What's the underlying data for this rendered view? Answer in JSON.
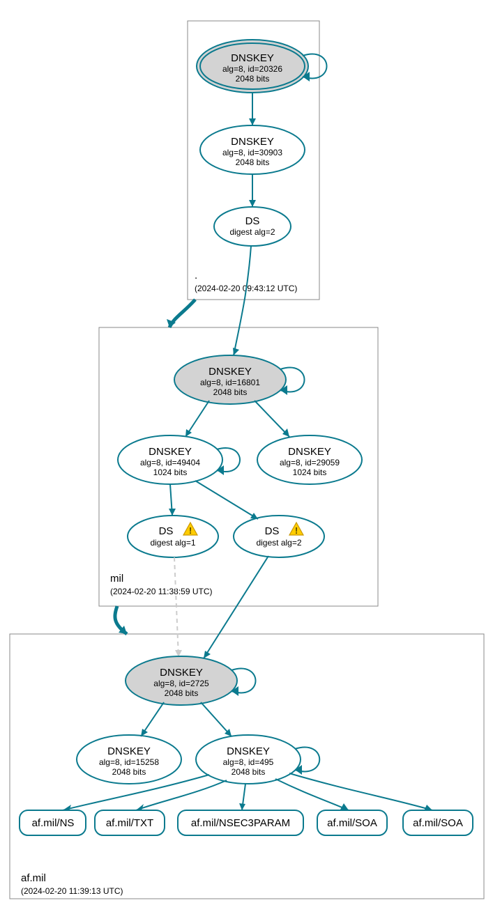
{
  "zones": {
    "root": {
      "label": ".",
      "time": "(2024-02-20 09:43:12 UTC)"
    },
    "mil": {
      "label": "mil",
      "time": "(2024-02-20 11:38:59 UTC)"
    },
    "afmil": {
      "label": "af.mil",
      "time": "(2024-02-20 11:39:13 UTC)"
    }
  },
  "nodes": {
    "root_ksk": {
      "t": "DNSKEY",
      "l1": "alg=8, id=20326",
      "l2": "2048 bits"
    },
    "root_zsk": {
      "t": "DNSKEY",
      "l1": "alg=8, id=30903",
      "l2": "2048 bits"
    },
    "root_ds": {
      "t": "DS",
      "l1": "digest alg=2"
    },
    "mil_ksk": {
      "t": "DNSKEY",
      "l1": "alg=8, id=16801",
      "l2": "2048 bits"
    },
    "mil_zsk1": {
      "t": "DNSKEY",
      "l1": "alg=8, id=49404",
      "l2": "1024 bits"
    },
    "mil_zsk2": {
      "t": "DNSKEY",
      "l1": "alg=8, id=29059",
      "l2": "1024 bits"
    },
    "mil_ds1": {
      "t": "DS",
      "l1": "digest alg=1"
    },
    "mil_ds2": {
      "t": "DS",
      "l1": "digest alg=2"
    },
    "af_ksk": {
      "t": "DNSKEY",
      "l1": "alg=8, id=2725",
      "l2": "2048 bits"
    },
    "af_zsk1": {
      "t": "DNSKEY",
      "l1": "alg=8, id=15258",
      "l2": "2048 bits"
    },
    "af_zsk2": {
      "t": "DNSKEY",
      "l1": "alg=8, id=495",
      "l2": "2048 bits"
    }
  },
  "rrsets": {
    "ns": "af.mil/NS",
    "txt": "af.mil/TXT",
    "n3p": "af.mil/NSEC3PARAM",
    "soa1": "af.mil/SOA",
    "soa2": "af.mil/SOA"
  }
}
